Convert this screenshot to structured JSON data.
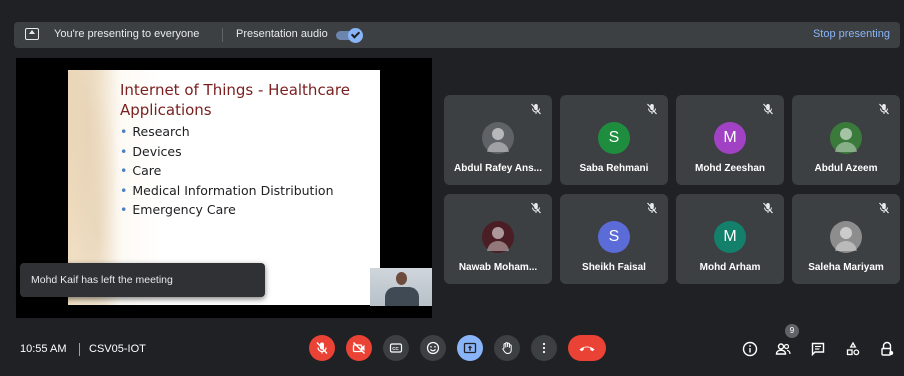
{
  "banner": {
    "presenting_text": "You're presenting to everyone",
    "audio_label": "Presentation audio",
    "audio_on": true,
    "stop_label": "Stop presenting"
  },
  "slide": {
    "title": "Internet of Things - Healthcare Applications",
    "bullets": [
      "Research",
      "Devices",
      "Care",
      "Medical Information Distribution",
      "Emergency Care"
    ]
  },
  "toast": "Mohd Kaif has left the meeting",
  "participants": [
    {
      "name": "Abdul Rafey Ans...",
      "avatar": "photo",
      "color": "#5f6368",
      "initial": ""
    },
    {
      "name": "Saba Rehmani",
      "avatar": "initial",
      "color": "#1e8e3e",
      "initial": "S"
    },
    {
      "name": "Mohd Zeeshan",
      "avatar": "initial",
      "color": "#a142c4",
      "initial": "M"
    },
    {
      "name": "Abdul Azeem",
      "avatar": "photo",
      "color": "#3a7a3a",
      "initial": ""
    },
    {
      "name": "Nawab Moham...",
      "avatar": "photo",
      "color": "#4a1e24",
      "initial": ""
    },
    {
      "name": "Sheikh Faisal",
      "avatar": "initial",
      "color": "#5b6bd8",
      "initial": "S"
    },
    {
      "name": "Mohd Arham",
      "avatar": "initial",
      "color": "#12806b",
      "initial": "M"
    },
    {
      "name": "Saleha Mariyam",
      "avatar": "photo",
      "color": "#8d8d8d",
      "initial": ""
    }
  ],
  "bottom": {
    "time": "10:55 AM",
    "meeting_code": "CSV05-IOT",
    "participant_count": "9"
  },
  "colors": {
    "background": "#202124",
    "tile": "#3c4043",
    "accent": "#8ab4f8",
    "danger": "#ea4335"
  }
}
